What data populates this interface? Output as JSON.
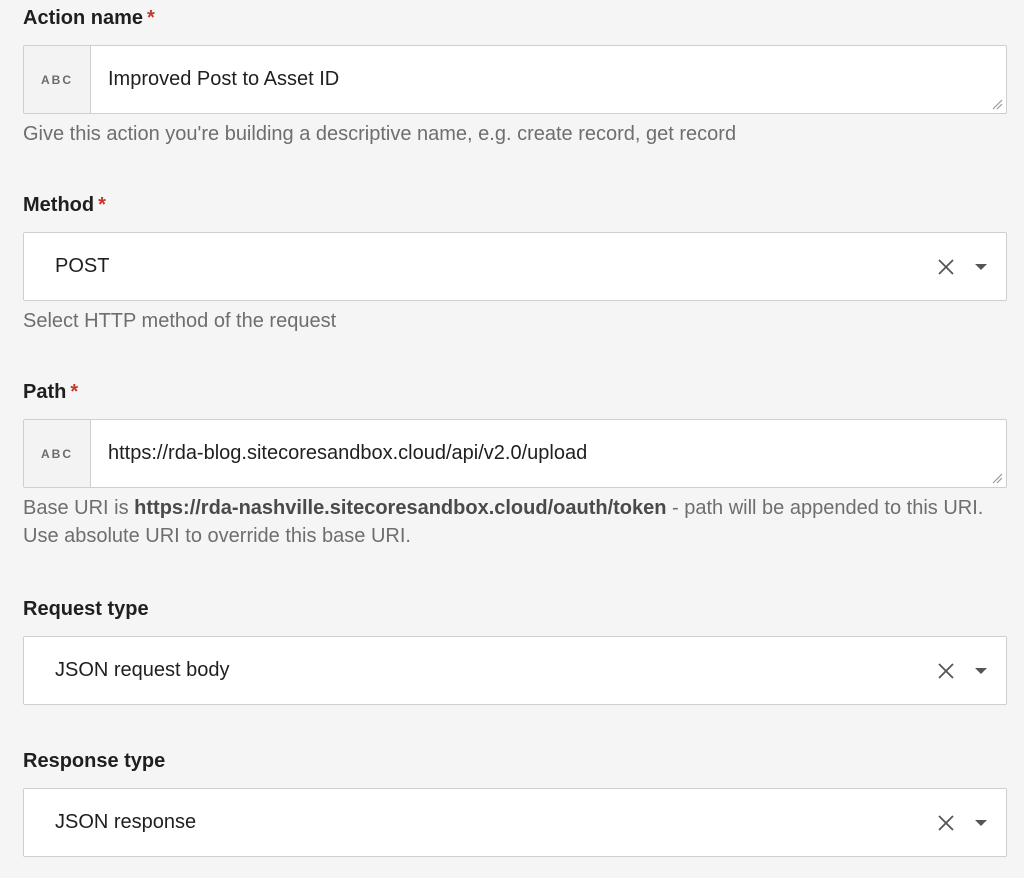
{
  "action_name": {
    "label": "Action name",
    "required_mark": "*",
    "type_tag": "ABC",
    "value": "Improved Post to Asset ID",
    "help": "Give this action you're building a descriptive name, e.g. create record, get record"
  },
  "method": {
    "label": "Method",
    "required_mark": "*",
    "value": "POST",
    "help": "Select HTTP method of the request"
  },
  "path": {
    "label": "Path",
    "required_mark": "*",
    "type_tag": "ABC",
    "value": "https://rda-blog.sitecoresandbox.cloud/api/v2.0/upload",
    "help_prefix": "Base URI is ",
    "help_base_uri": "https://rda-nashville.sitecoresandbox.cloud/oauth/token",
    "help_suffix": " - path will be appended to this URI. Use absolute URI to override this base URI."
  },
  "request_type": {
    "label": "Request type",
    "value": "JSON request body"
  },
  "response_type": {
    "label": "Response type",
    "value": "JSON response"
  },
  "icons": {
    "clear": "close-icon",
    "dropdown": "caret-down-icon",
    "resize": "resize-handle-icon"
  }
}
